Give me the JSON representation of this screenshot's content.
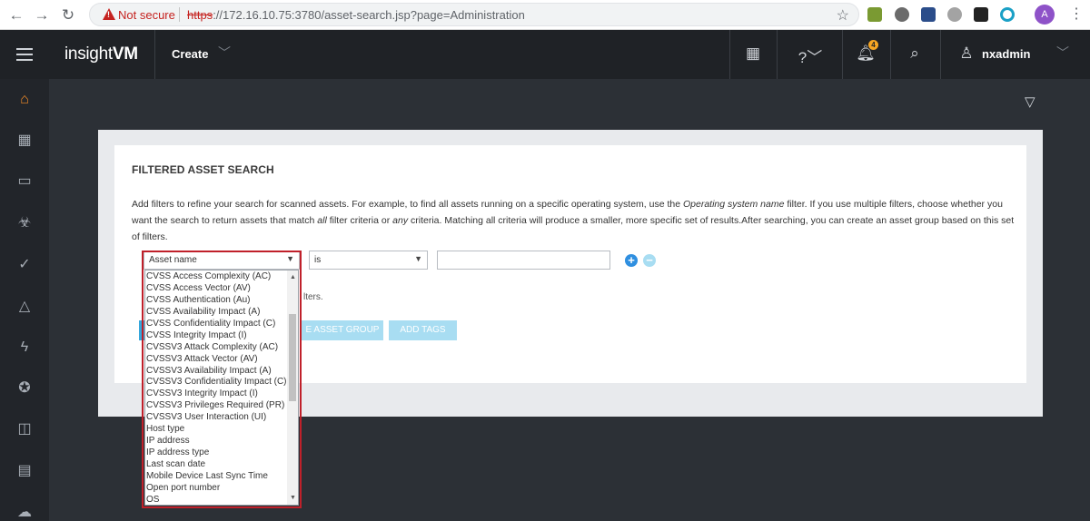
{
  "browser": {
    "not_secure": "Not secure",
    "url_scheme": "https",
    "url_rest": "://172.16.10.75:3780/asset-search.jsp?page=Administration",
    "profile_initial": "A"
  },
  "header": {
    "brand_light": "insight",
    "brand_bold": "VM",
    "create_label": "Create",
    "notification_count": "4",
    "username": "nxadmin"
  },
  "main": {
    "title": "FILTERED ASSET SEARCH",
    "desc_part1": "Add filters to refine your search for scanned assets. For example, to find all assets running on a specific operating system, use the ",
    "desc_italic1": "Operating system name",
    "desc_part2": "  filter. If you use multiple filters, choose whether you want the search to return assets that match ",
    "desc_italic2": "all",
    "desc_part3": "  filter criteria or ",
    "desc_italic3": "any",
    "desc_part4": "  criteria. Matching all criteria will produce a smaller, more specific set of results.After searching, you can create an asset group based on this set of filters.",
    "filter_field_value": "Asset name",
    "operator_value": "is",
    "filters_text": "lters.",
    "create_group_partial": "E ASSET GROUP",
    "add_tags_label": "ADD TAGS"
  },
  "dropdown": {
    "options": [
      "CVSS Access Complexity (AC)",
      "CVSS Access Vector (AV)",
      "CVSS Authentication (Au)",
      "CVSS Availability Impact (A)",
      "CVSS Confidentiality Impact (C)",
      "CVSS Integrity Impact (I)",
      "CVSSV3 Attack Complexity (AC)",
      "CVSSV3 Attack Vector (AV)",
      "CVSSV3 Availability Impact (A)",
      "CVSSV3 Confidentiality Impact (C)",
      "CVSSV3 Integrity Impact (I)",
      "CVSSV3 Privileges Required (PR)",
      "CVSSV3 User Interaction (UI)",
      "Host type",
      "IP address",
      "IP address type",
      "Last scan date",
      "Mobile Device Last Sync Time",
      "Open port number",
      "OS"
    ]
  },
  "colors": {
    "accent_orange": "#f28c28",
    "add_blue": "#2f8fe0",
    "highlight_red": "#c0202a"
  }
}
